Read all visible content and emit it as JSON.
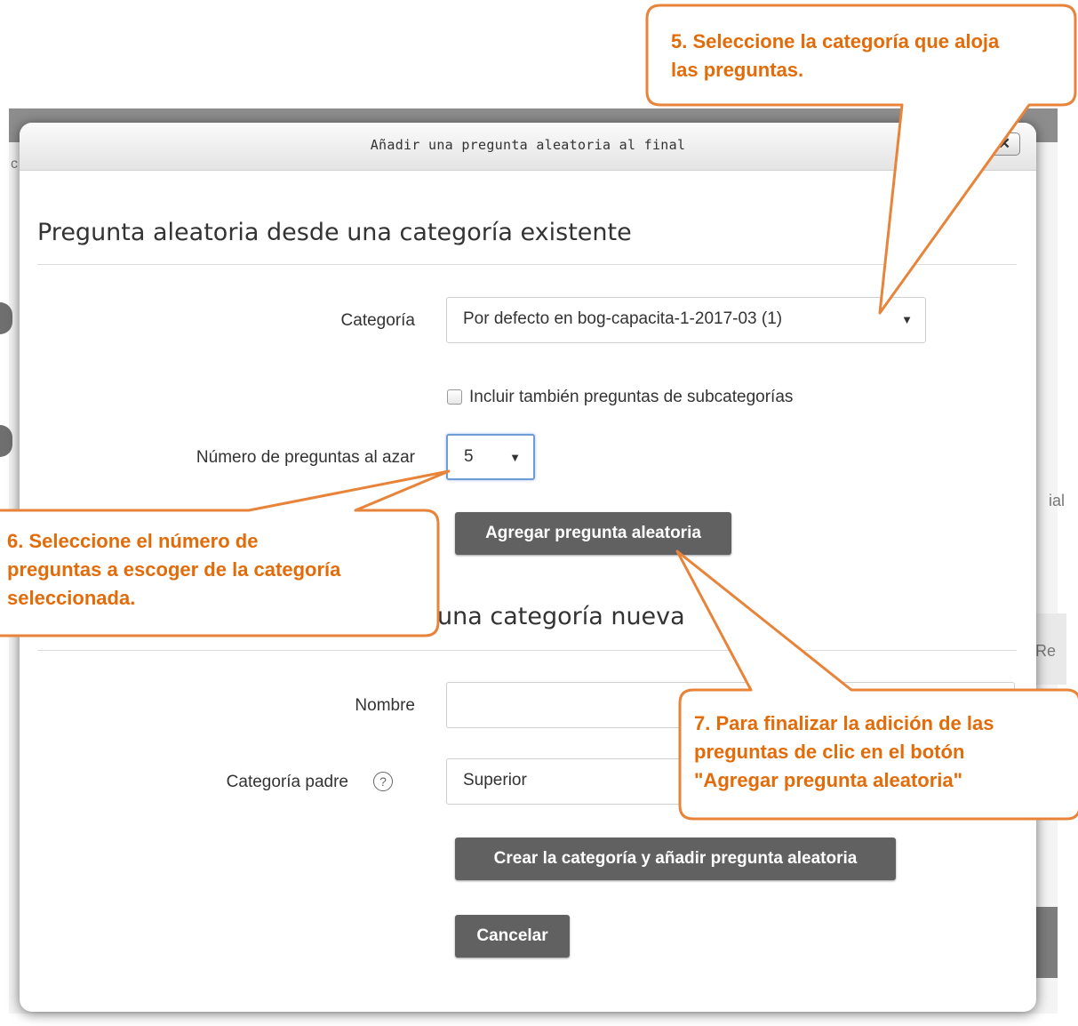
{
  "background": {
    "frag_right1": "ial",
    "frag_right2": "Re",
    "frag_left": "c"
  },
  "modal": {
    "title": "Añadir una pregunta aleatoria al final",
    "close_label": "✕"
  },
  "existing_section": {
    "heading": "Pregunta aleatoria desde una categoría existente",
    "category_label": "Categoría",
    "category_value": "Por defecto en bog-capacita-1-2017-03 (1)",
    "include_subcategories_label": "Incluir también preguntas de subcategorías",
    "include_subcategories_checked": false,
    "number_label": "Número de preguntas al azar",
    "number_value": "5",
    "add_button": "Agregar pregunta aleatoria"
  },
  "new_section": {
    "heading": "una categoría nueva",
    "name_label": "Nombre",
    "name_value": "",
    "parent_label": "Categoría padre",
    "parent_value": "Superior",
    "create_button": "Crear la categoría y añadir pregunta aleatoria",
    "cancel_button": "Cancelar"
  },
  "callouts": {
    "c5_line1": "5.  Seleccione la categoría que aloja",
    "c5_line2": "las preguntas.",
    "c6_line1": "6.  Seleccione el número de",
    "c6_line2": "preguntas a escoger de la categoría",
    "c6_line3": "seleccionada.",
    "c7_line1": "7.  Para finalizar la adición de las",
    "c7_line2": "preguntas de clic en el botón",
    "c7_line3": "\"Agregar pregunta aleatoria\""
  },
  "colors": {
    "callout_orange": "#e36c0a",
    "button_gray": "#616161"
  },
  "icons": {
    "close": "close-icon",
    "help": "help-icon",
    "dropdown": "chevron-down-icon"
  }
}
